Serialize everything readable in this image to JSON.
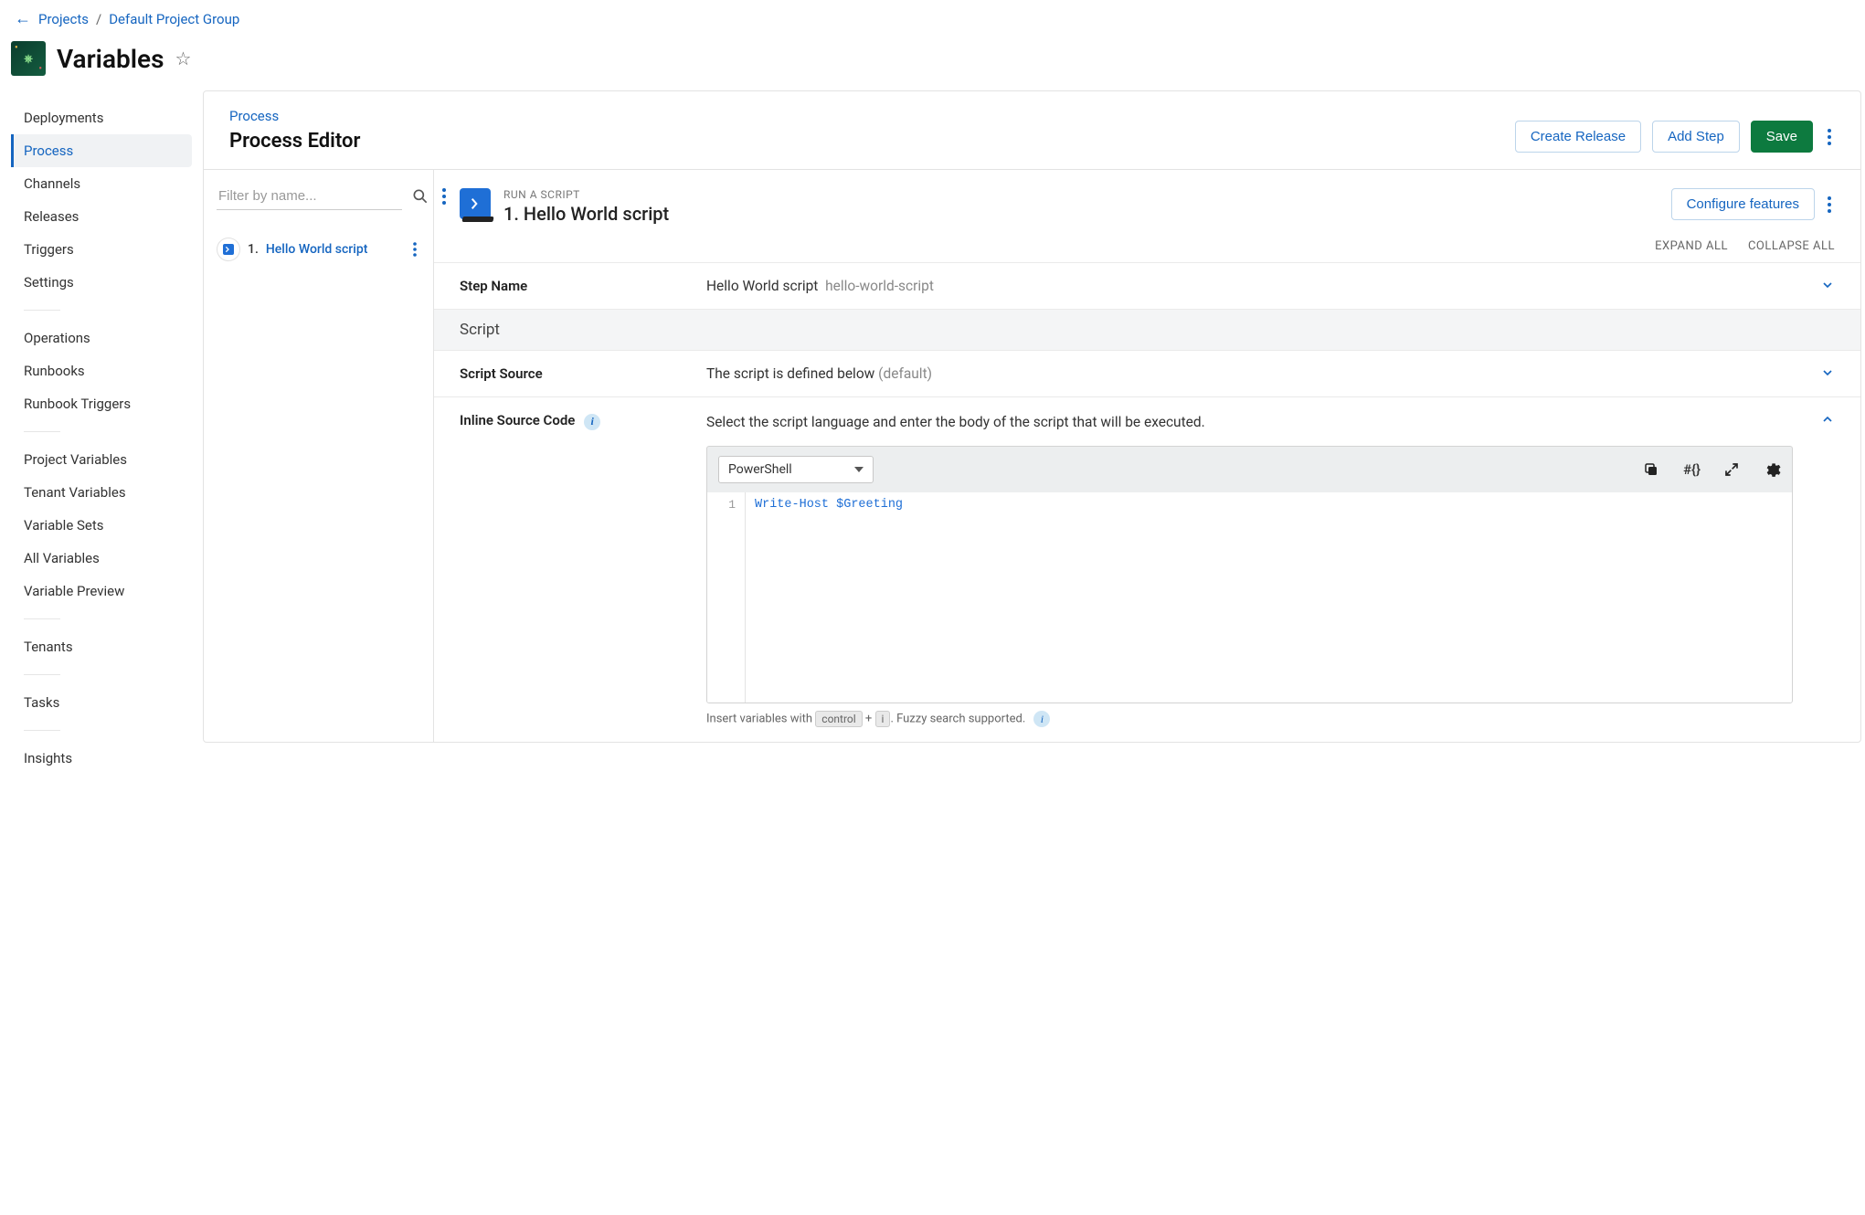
{
  "breadcrumb": {
    "items": [
      "Projects",
      "Default Project Group"
    ]
  },
  "page": {
    "title": "Variables"
  },
  "sidebar": {
    "groups": [
      [
        "Deployments",
        "Process",
        "Channels",
        "Releases",
        "Triggers",
        "Settings"
      ],
      [
        "Operations",
        "Runbooks",
        "Runbook Triggers"
      ],
      [
        "Project Variables",
        "Tenant Variables",
        "Variable Sets",
        "All Variables",
        "Variable Preview"
      ],
      [
        "Tenants"
      ],
      [
        "Tasks"
      ],
      [
        "Insights"
      ]
    ],
    "active": "Process"
  },
  "main": {
    "crumb": "Process",
    "heading": "Process Editor",
    "buttons": {
      "create_release": "Create Release",
      "add_step": "Add Step",
      "save": "Save"
    }
  },
  "steps": {
    "filter_placeholder": "Filter by name...",
    "items": [
      {
        "num": "1.",
        "name": "Hello World script"
      }
    ]
  },
  "detail": {
    "kicker": "RUN A SCRIPT",
    "title_num": "1.",
    "title_name": "Hello World script",
    "configure_btn": "Configure features",
    "expand_all": "EXPAND ALL",
    "collapse_all": "COLLAPSE ALL",
    "step_name": {
      "label": "Step Name",
      "value": "Hello World script",
      "slug": "hello-world-script"
    },
    "script_band": "Script",
    "script_source": {
      "label": "Script Source",
      "value": "The script is defined below",
      "suffix": "(default)"
    },
    "inline_code": {
      "label": "Inline Source Code",
      "desc": "Select the script language and enter the body of the script that will be executed.",
      "language": "PowerShell",
      "line_num": "1",
      "code_cmd": "Write-Host",
      "code_var": "$Greeting",
      "hint_pre": "Insert variables with ",
      "hint_kbd1": "control",
      "hint_plus": " + ",
      "hint_kbd2": "i",
      "hint_post": ". Fuzzy search supported. "
    }
  }
}
